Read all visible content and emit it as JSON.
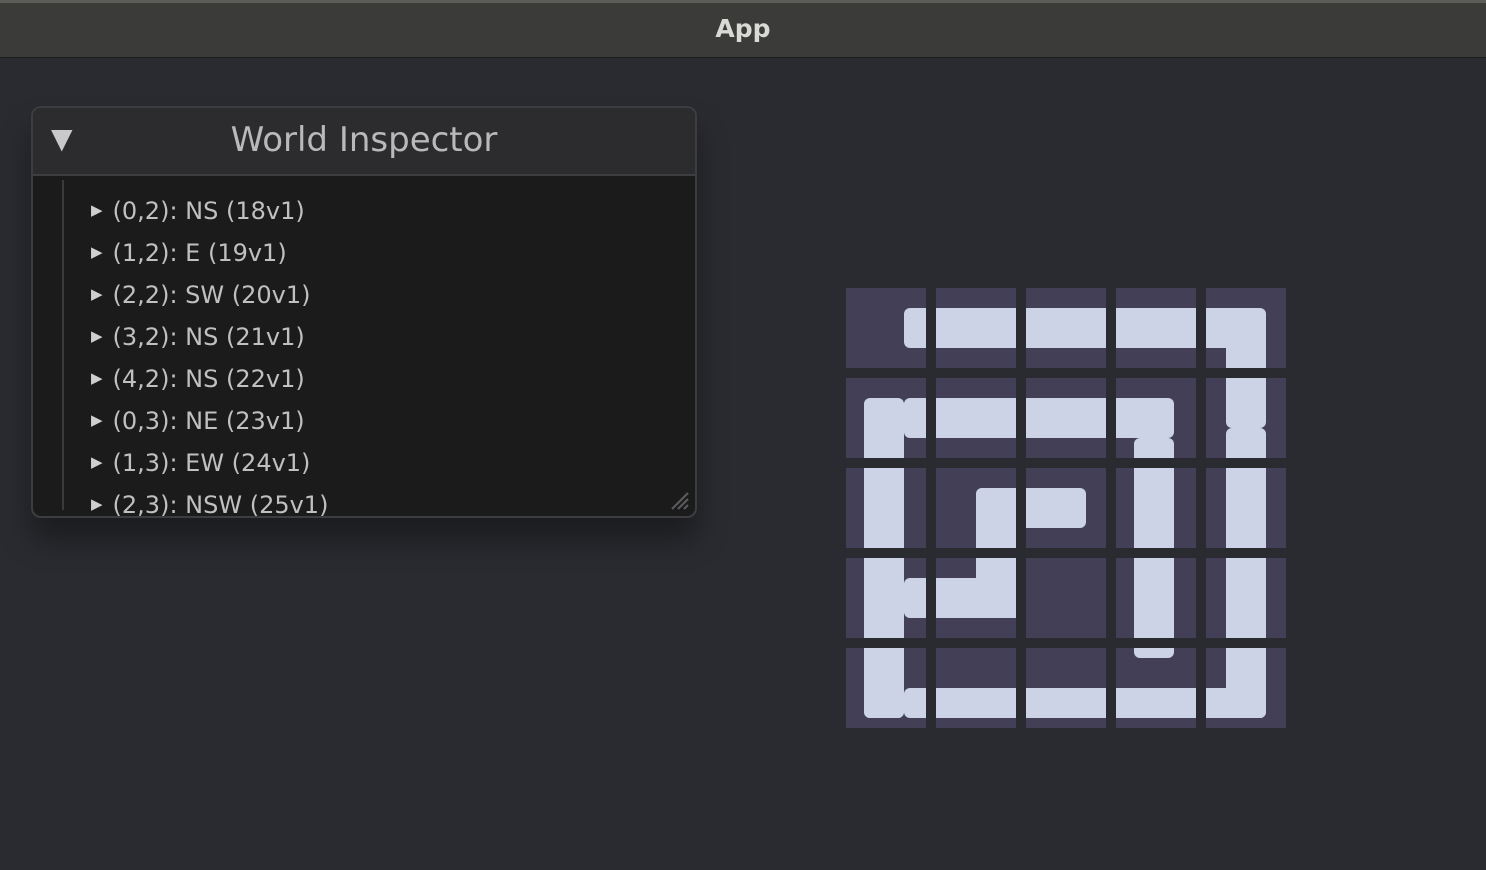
{
  "window": {
    "title": "App"
  },
  "inspector": {
    "title": "World Inspector",
    "items": [
      {
        "label": "(0,2): NS (18v1)"
      },
      {
        "label": "(1,2): E (19v1)"
      },
      {
        "label": "(2,2): SW (20v1)"
      },
      {
        "label": "(3,2): NS (21v1)"
      },
      {
        "label": "(4,2): NS (22v1)"
      },
      {
        "label": "(0,3): NE (23v1)"
      },
      {
        "label": "(1,3): EW (24v1)"
      },
      {
        "label": "(2,3): NSW (25v1)"
      }
    ]
  },
  "colors": {
    "background": "#2a2b30",
    "tile_dark": "#433f57",
    "tile_light": "#ccd3e6"
  }
}
